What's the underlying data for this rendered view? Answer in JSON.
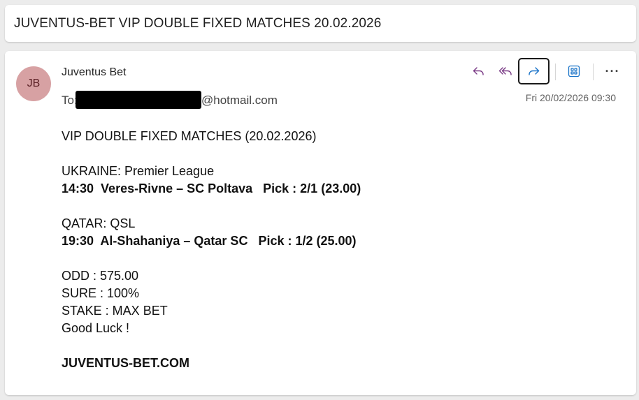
{
  "subject": "JUVENTUS-BET VIP DOUBLE FIXED MATCHES 20.02.2026",
  "sender": {
    "initials": "JB",
    "name": "Juventus Bet",
    "avatar_color": "#d7a1a3"
  },
  "recipient": {
    "label": "To:",
    "visible_address": "@hotmail.com"
  },
  "date": "Fri 20/02/2026 09:30",
  "toolbar": {
    "reply_icon": "reply-icon",
    "reply_all_icon": "reply-all-icon",
    "forward_icon": "forward-icon",
    "apps_icon": "apps-icon",
    "more_label": "···"
  },
  "message": {
    "heading": "VIP DOUBLE FIXED MATCHES (20.02.2026)",
    "match1_league": "UKRAINE: Premier League",
    "match1_line": "14:30  Veres-Rivne – SC Poltava   Pick : 2/1 (23.00)",
    "match2_league": "QATAR: QSL",
    "match2_line": "19:30  Al-Shahaniya – Qatar SC   Pick : 1/2 (25.00)",
    "odd": "ODD : 575.00",
    "sure": "SURE : 100%",
    "stake": "STAKE : MAX BET",
    "luck": "Good Luck !",
    "site": "JUVENTUS-BET.COM"
  }
}
